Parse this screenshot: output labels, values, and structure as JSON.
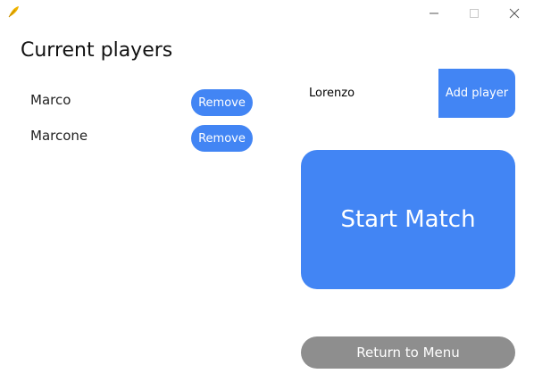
{
  "window": {
    "app_icon": "feather-icon",
    "controls": {
      "minimize_icon": "minimize-icon",
      "maximize_icon": "maximize-icon",
      "close_icon": "close-icon"
    }
  },
  "players_panel": {
    "title": "Current players",
    "players": [
      {
        "name": "Marco",
        "remove_label": "Remove"
      },
      {
        "name": "Marcone",
        "remove_label": "Remove"
      }
    ]
  },
  "add_player": {
    "input_value": "Lorenzo",
    "button_label": "Add player"
  },
  "start_button_label": "Start Match",
  "menu_button_label": "Return to Menu",
  "colors": {
    "accent": "#4285f4",
    "secondary_button": "#8e8e8e",
    "app_icon": "#f0b400",
    "background": "#ffffff"
  }
}
